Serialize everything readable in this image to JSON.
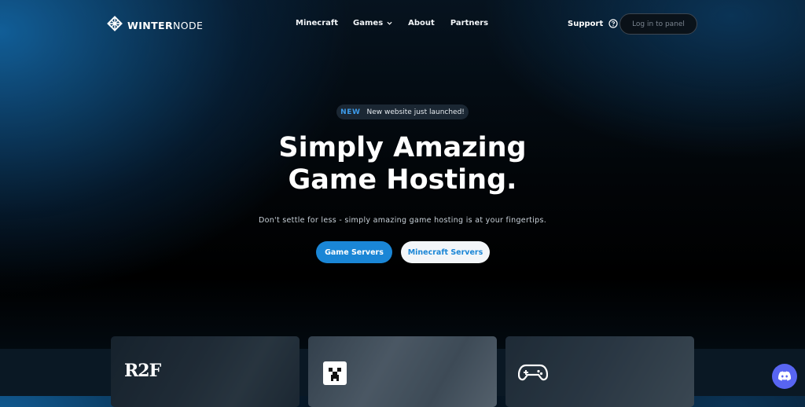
{
  "brand": {
    "name_bold": "WINTER",
    "name_regular": "NODE"
  },
  "nav": {
    "items": [
      {
        "label": "Minecraft"
      },
      {
        "label": "Games"
      },
      {
        "label": "About"
      },
      {
        "label": "Partners"
      }
    ],
    "support_label": "Support",
    "login_label": "Log in to panel"
  },
  "hero": {
    "badge_new": "NEW",
    "badge_text": "New website just launched!",
    "title_line1": "Simply Amazing",
    "title_line2": "Game Hosting.",
    "subtitle": "Don't settle for less - simply amazing game hosting is at your fingertips.",
    "primary_button": "Game Servers",
    "secondary_button": "Minecraft Servers"
  },
  "cards": {
    "card1_logo": "R2F"
  },
  "icons": {
    "logo": "snowflake-icon",
    "games_dropdown": "chevron-down-icon",
    "support": "question-circle-icon",
    "card2": "creeper-icon",
    "card3": "gamepad-icon",
    "chat": "discord-icon"
  },
  "colors": {
    "accent": "#1a86d6",
    "badge_new": "#3d9be9",
    "discord": "#5865f2"
  }
}
